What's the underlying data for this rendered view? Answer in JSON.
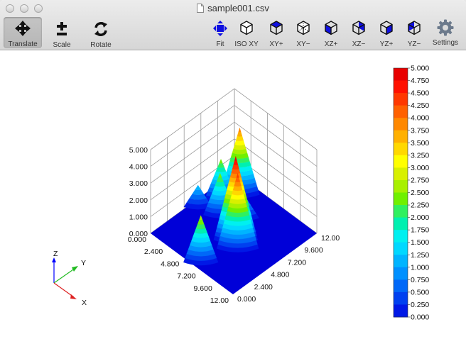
{
  "window": {
    "title": "sample001.csv"
  },
  "toolbar": {
    "translate": "Translate",
    "scale": "Scale",
    "rotate": "Rotate",
    "fit": "Fit",
    "iso_xy": "ISO XY",
    "xy_plus": "XY+",
    "xy_minus": "XY−",
    "xz_plus": "XZ+",
    "xz_minus": "XZ−",
    "yz_plus": "YZ+",
    "yz_minus": "YZ−",
    "settings": "Settings"
  },
  "colors": {
    "accent": "#0000cc",
    "background": "#ffffff"
  },
  "chart_data": {
    "type": "surface3d",
    "z_axis_ticks": [
      "0.000",
      "1.000",
      "2.000",
      "3.000",
      "4.000",
      "5.000"
    ],
    "x_axis_ticks": [
      "0.000",
      "2.400",
      "4.800",
      "7.200",
      "9.600",
      "12.00"
    ],
    "y_axis_ticks": [
      "0.000",
      "2.400",
      "4.800",
      "7.200",
      "9.600",
      "12.00"
    ],
    "zlim": [
      0,
      5
    ],
    "xlim": [
      0,
      12
    ],
    "ylim": [
      0,
      12
    ],
    "colorbar_ticks": [
      "5.000",
      "4.750",
      "4.500",
      "4.250",
      "4.000",
      "3.750",
      "3.500",
      "3.250",
      "3.000",
      "2.750",
      "2.500",
      "2.250",
      "2.000",
      "1.750",
      "1.500",
      "1.250",
      "1.000",
      "0.750",
      "0.500",
      "0.250",
      "0.000"
    ],
    "colorbar_range": [
      0,
      5
    ],
    "peaks": [
      {
        "x": 6.5,
        "y": 0.8,
        "z": 2.8
      },
      {
        "x": 6.8,
        "y": 5.5,
        "z": 5.0
      },
      {
        "x": 7.8,
        "y": 4.8,
        "z": 4.5
      },
      {
        "x": 3.2,
        "y": 6.8,
        "z": 2.5
      },
      {
        "x": 6.4,
        "y": 6.8,
        "z": 1.5
      },
      {
        "x": 5.3,
        "y": 8.3,
        "z": 1.3
      },
      {
        "x": 0.8,
        "y": 6.0,
        "z": 1.3
      },
      {
        "x": 2.6,
        "y": 10.2,
        "z": 4.0
      },
      {
        "x": 1.7,
        "y": 8.4,
        "z": 2.4
      }
    ],
    "gizmo": {
      "z_label": "Z",
      "y_label": "Y",
      "x_label": "X"
    }
  }
}
